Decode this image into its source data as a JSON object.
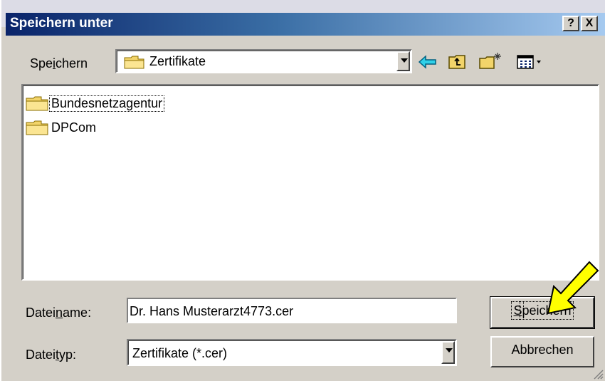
{
  "dialog": {
    "title": "Speichern unter",
    "help_label": "?",
    "close_label": "X"
  },
  "look_in": {
    "label_pre": "Spe",
    "label_ul": "i",
    "label_post": "chern",
    "value": "Zertifikate"
  },
  "toolbar": {
    "back_icon": "back-arrow-icon",
    "up_icon": "up-one-level-icon",
    "new_folder_icon": "new-folder-icon",
    "view_icon": "view-menu-icon"
  },
  "files": [
    {
      "name": "Bundesnetzagentur",
      "icon": "folder-icon",
      "selected": true
    },
    {
      "name": "DPCom",
      "icon": "folder-icon",
      "selected": false
    }
  ],
  "filename": {
    "label_pre": "Datei",
    "label_ul": "n",
    "label_post": "ame:",
    "value": "Dr. Hans Musterarzt4773.cer"
  },
  "filetype": {
    "label_pre": "Datei",
    "label_ul": "t",
    "label_post": "yp:",
    "value": "Zertifikate (*.cer)"
  },
  "buttons": {
    "save_ul": "S",
    "save_rest": "peichern",
    "cancel_label": "Abbrechen"
  },
  "colors": {
    "title_start": "#0a246a",
    "title_end": "#a6caf0",
    "face": "#d4d0c8",
    "annotation_arrow": "#ffff00"
  }
}
